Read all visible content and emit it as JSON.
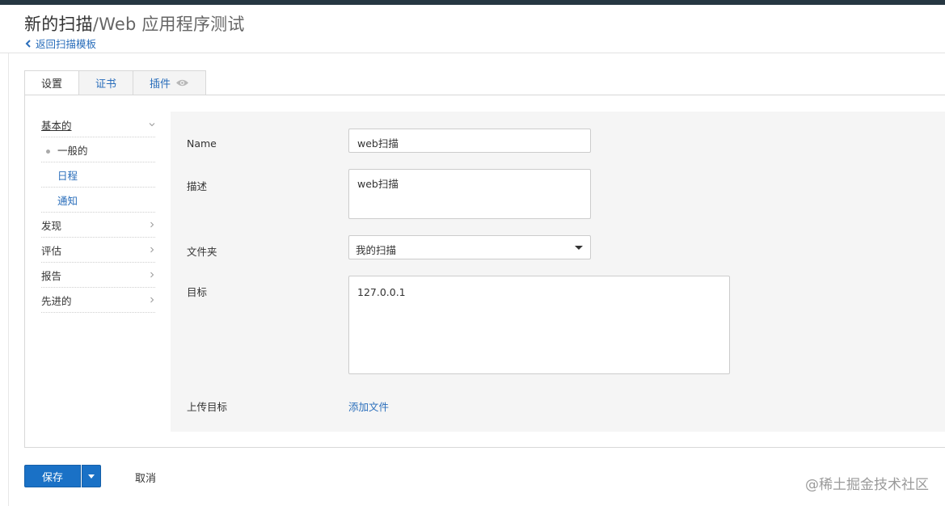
{
  "page": {
    "title_main": "新的扫描",
    "title_rest": "/Web 应用程序测试",
    "back_link": "返回扫描模板"
  },
  "tabs": [
    {
      "label": "设置",
      "active": true
    },
    {
      "label": "证书",
      "active": false
    },
    {
      "label": "插件",
      "active": false,
      "icon": "eye-icon"
    }
  ],
  "sidenav": {
    "basic": "基本的",
    "general": "一般的",
    "schedule": "日程",
    "notify": "通知",
    "discovery": "发现",
    "assessment": "评估",
    "report": "报告",
    "advanced": "先进的"
  },
  "form": {
    "name_label": "Name",
    "name_value": "web扫描",
    "desc_label": "描述",
    "desc_value": "web扫描",
    "folder_label": "文件夹",
    "folder_value": "我的扫描",
    "target_label": "目标",
    "target_value": "127.0.0.1",
    "upload_label": "上传目标",
    "upload_link": "添加文件"
  },
  "actions": {
    "save": "保存",
    "cancel": "取消"
  },
  "watermark": "@稀土掘金技术社区",
  "colors": {
    "accent": "#1a71c6",
    "link": "#2a6ebb",
    "topbar": "#263742",
    "form_bg": "#f5f5f5"
  }
}
